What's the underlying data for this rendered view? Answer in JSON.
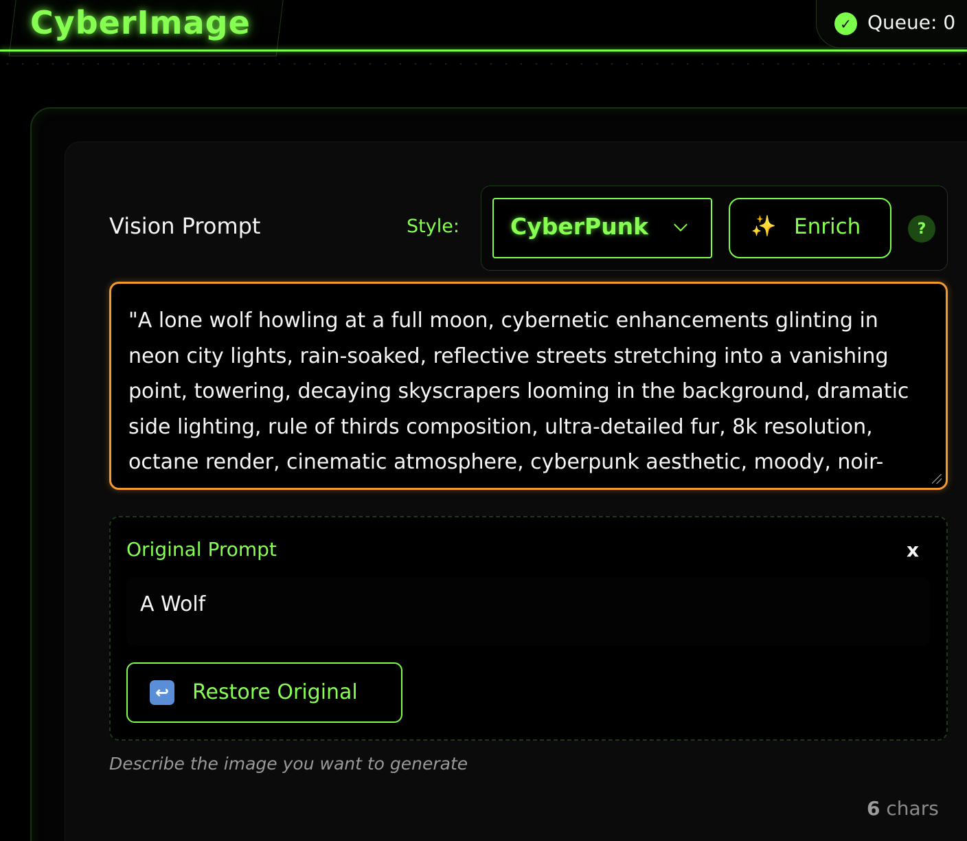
{
  "header": {
    "app_title": "CyberImage",
    "queue_label": "Queue: 0"
  },
  "prompt_section": {
    "label": "Vision Prompt",
    "style_label": "Style:",
    "style_value": "CyberPunk",
    "enrich_label": "Enrich",
    "help_label": "?",
    "prompt_value": "\"A lone wolf howling at a full moon, cybernetic enhancements glinting in neon city lights, rain-soaked, reflective streets stretching into a vanishing point, towering, decaying skyscrapers looming in the background, dramatic side lighting, rule of thirds composition, ultra-detailed fur, 8k resolution, octane render, cinematic atmosphere, cyberpunk aesthetic, moody, noir-like.\""
  },
  "original_prompt": {
    "label": "Original Prompt",
    "close_label": "x",
    "value": "A Wolf",
    "restore_label": "Restore Original"
  },
  "footer": {
    "helper_text": "Describe the image you want to generate",
    "char_count_number": "6",
    "char_count_unit": "chars"
  },
  "colors": {
    "accent": "#7CFF4A",
    "focus_border": "#F39A2E",
    "background": "#000000"
  },
  "icons": {
    "queue_status": "check-circle-icon",
    "style_dropdown": "chevron-down-icon",
    "enrich": "sparkles-icon",
    "help": "question-icon",
    "restore": "return-arrow-icon"
  }
}
